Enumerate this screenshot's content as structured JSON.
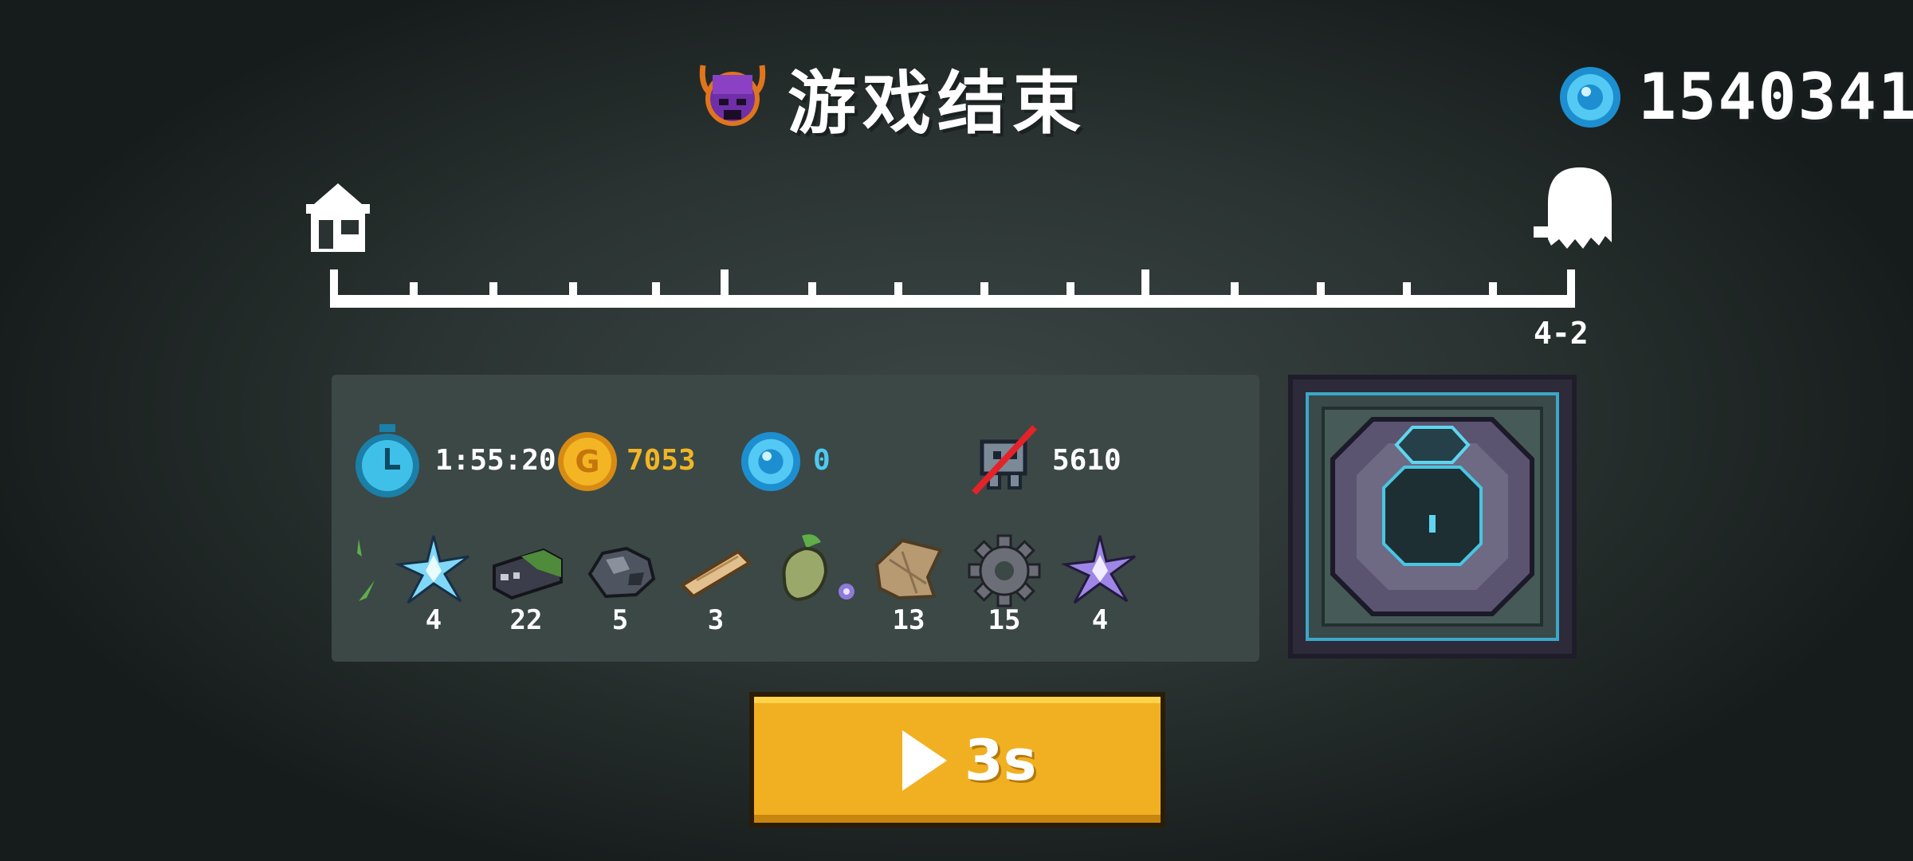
{
  "header": {
    "title": "游戏结束",
    "gem_total": "1540341",
    "icons": {
      "title": "demon-helmet-icon",
      "gems": "blue-gem-icon"
    }
  },
  "progress": {
    "stage_label": "4-2",
    "start_icon": "home-icon",
    "end_icon": "ghost-icon"
  },
  "stats": {
    "time": "1:55:20",
    "gold": "7053",
    "gems": "0",
    "kills": "5610",
    "colors": {
      "gold_text": "#f3b524",
      "gem_text": "#4ec9f2"
    }
  },
  "loot": [
    {
      "icon": "blue-crystal-icon",
      "count": "4"
    },
    {
      "icon": "dark-ore-block-icon",
      "count": "22"
    },
    {
      "icon": "coal-lump-icon",
      "count": "5"
    },
    {
      "icon": "wood-plank-icon",
      "count": "3"
    },
    {
      "icon": "seed-pod-icon",
      "count": ""
    },
    {
      "icon": "cloth-scrap-icon",
      "count": "13"
    },
    {
      "icon": "gear-part-icon",
      "count": "15"
    },
    {
      "icon": "purple-crystal-icon",
      "count": "4"
    }
  ],
  "continue_button": {
    "countdown": "3s"
  }
}
